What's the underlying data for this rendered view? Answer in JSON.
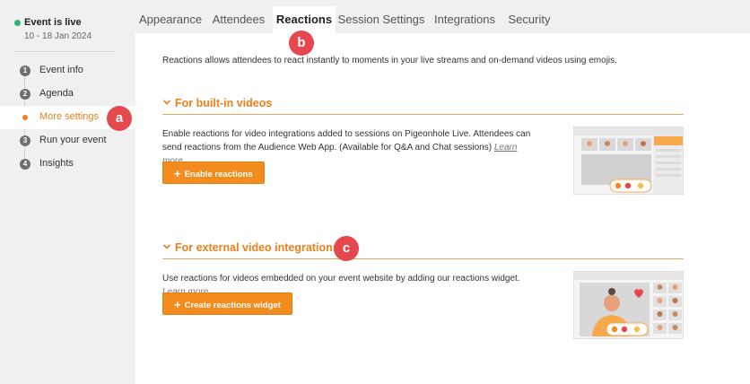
{
  "sidebar": {
    "status": {
      "label": "Event is live",
      "dates": "10 - 18 Jan 2024",
      "color": "#2bb673"
    },
    "steps": [
      {
        "num": "1",
        "label": "Event info"
      },
      {
        "num": "2",
        "label": "Agenda"
      },
      {
        "num": "",
        "label": "More settings",
        "active": true
      },
      {
        "num": "3",
        "label": "Run your event"
      },
      {
        "num": "4",
        "label": "Insights"
      }
    ]
  },
  "callouts": {
    "a": "a",
    "b": "b",
    "c": "c"
  },
  "tabs": [
    {
      "label": "Appearance"
    },
    {
      "label": "Attendees"
    },
    {
      "label": "Reactions",
      "active": true
    },
    {
      "label": "Session Settings"
    },
    {
      "label": "Integrations"
    },
    {
      "label": "Security"
    }
  ],
  "main": {
    "intro": "Reactions allows attendees to react instantly to moments in your live streams and on-demand videos using emojis.",
    "builtin": {
      "title": "For built-in videos",
      "description": "Enable reactions for video integrations added to sessions on Pigeonhole Live. Attendees can send reactions from the Audience Web App. (Available for Q&A and Chat sessions)",
      "learn_more": "Learn more",
      "button": "Enable reactions",
      "thumbnail_icon": "video-grid-illustration"
    },
    "external": {
      "title": "For external video integrations",
      "description": "Use reactions for videos embedded on your event website by adding our reactions widget.",
      "learn_more": "Learn more",
      "button": "Create reactions widget",
      "thumbnail_icon": "speaker-video-illustration"
    }
  },
  "colors": {
    "accent": "#ef7f1a",
    "callout": "#e5484d",
    "live": "#2bb673"
  }
}
